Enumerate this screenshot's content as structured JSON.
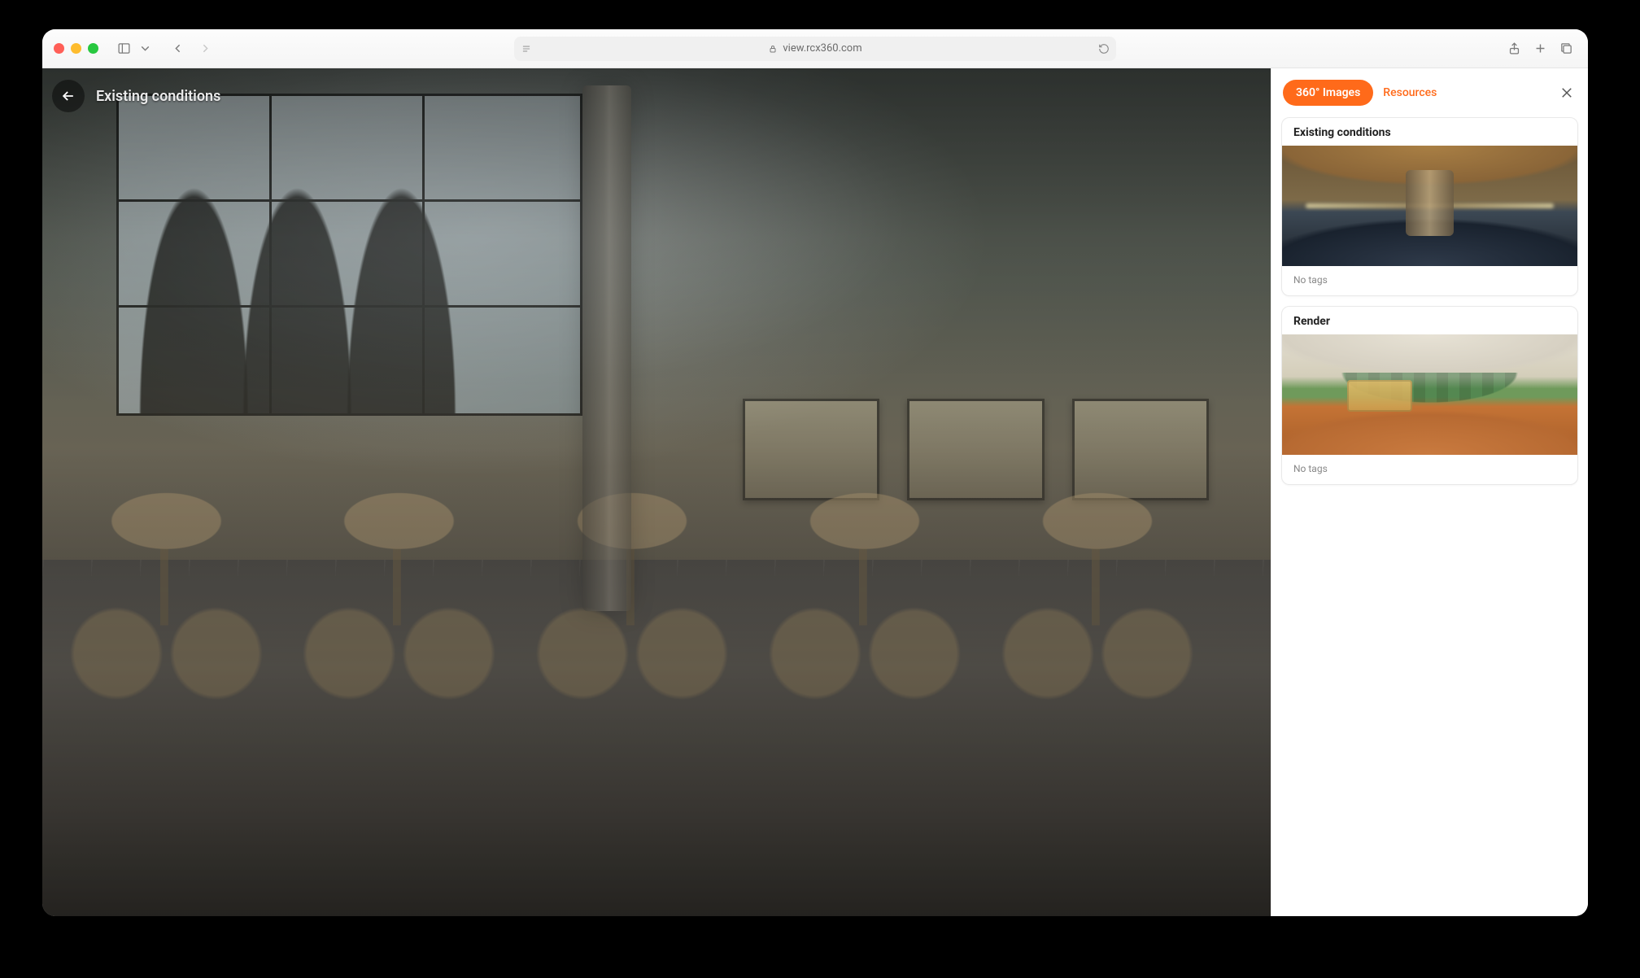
{
  "browser": {
    "url_host": "view.rcx360.com"
  },
  "viewer": {
    "title": "Existing conditions"
  },
  "sidebar": {
    "tabs": {
      "images": "360° Images",
      "resources": "Resources"
    },
    "cards": [
      {
        "title": "Existing conditions",
        "tags": "No tags"
      },
      {
        "title": "Render",
        "tags": "No tags"
      }
    ]
  }
}
